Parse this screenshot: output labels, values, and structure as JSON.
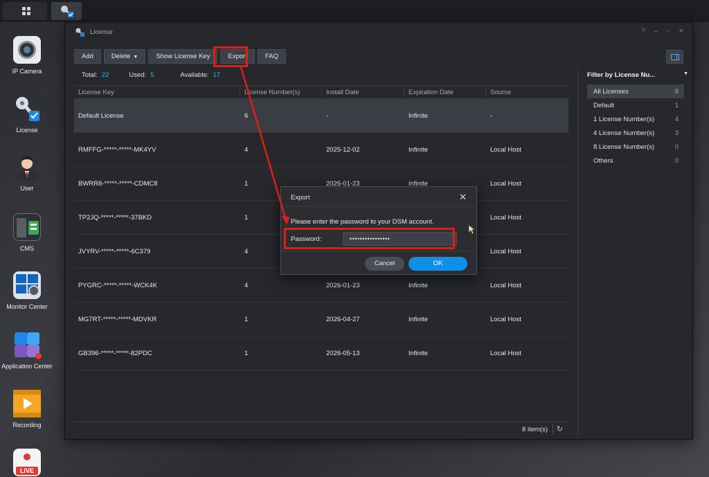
{
  "colors": {
    "accent": "#0f8fe8",
    "highlight": "#e01d1d",
    "window_bg": "#26282c"
  },
  "taskbar": {
    "grid_icon": "grid-icon",
    "active_app_icon": "license-icon"
  },
  "dock": [
    {
      "label": "IP Camera",
      "icon": "camera-icon"
    },
    {
      "label": "License",
      "icon": "key-icon"
    },
    {
      "label": "User",
      "icon": "user-icon"
    },
    {
      "label": "CMS",
      "icon": "cms-icon"
    },
    {
      "label": "Monitor Center",
      "icon": "monitor-icon"
    },
    {
      "label": "Application Center",
      "icon": "puzzle-icon"
    },
    {
      "label": "Recording",
      "icon": "film-icon"
    },
    {
      "label": "",
      "icon": "live-icon",
      "badge": "LIVE"
    }
  ],
  "window": {
    "title": "License",
    "controls": [
      "?",
      "–",
      "▫",
      "✕"
    ]
  },
  "toolbar": {
    "add": "Add",
    "delete": "Delete",
    "show_key": "Show License Key",
    "export": "Export",
    "faq": "FAQ"
  },
  "stats": {
    "total_label": "Total:",
    "total": "22",
    "used_label": "Used:",
    "used": "5",
    "available_label": "Available:",
    "available": "17"
  },
  "table": {
    "headers": [
      "License Key",
      "License Number(s)",
      "Install Date",
      "Expiration Date",
      "Source"
    ],
    "rows": [
      [
        "Default License",
        "6",
        "-",
        "Infinite",
        "-"
      ],
      [
        "RMFFG-*****-*****-MK4YV",
        "4",
        "2025-12-02",
        "Infinite",
        "Local Host"
      ],
      [
        "BWRR8-*****-*****-CDMC8",
        "1",
        "2026-01-23",
        "Infinite",
        "Local Host"
      ],
      [
        "TP2JQ-*****-*****-37BKD",
        "1",
        "",
        "",
        "Local Host"
      ],
      [
        "JVYRV-*****-*****-6C379",
        "4",
        "",
        "",
        "Local Host"
      ],
      [
        "PYGRC-*****-*****-WCK4K",
        "4",
        "2026-01-23",
        "Infinite",
        "Local Host"
      ],
      [
        "MG7RT-*****-*****-MDVKR",
        "1",
        "2026-04-27",
        "Infinite",
        "Local Host"
      ],
      [
        "GB396-*****-*****-82PDC",
        "1",
        "2026-05-13",
        "Infinite",
        "Local Host"
      ]
    ],
    "item_count": "8 item(s)"
  },
  "filter": {
    "title": "Filter by License Nu...",
    "items": [
      {
        "label": "All Licenses",
        "count": "8"
      },
      {
        "label": "Default",
        "count": "1"
      },
      {
        "label": "1 License Number(s)",
        "count": "4"
      },
      {
        "label": "4 License Number(s)",
        "count": "3"
      },
      {
        "label": "8 License Number(s)",
        "count": "0"
      },
      {
        "label": "Others",
        "count": "0"
      }
    ]
  },
  "dialog": {
    "title": "Export",
    "message": "Please enter the password to your DSM account.",
    "password_label": "Password:",
    "password_value": "••••••••••••••••",
    "cancel": "Cancel",
    "ok": "OK"
  }
}
